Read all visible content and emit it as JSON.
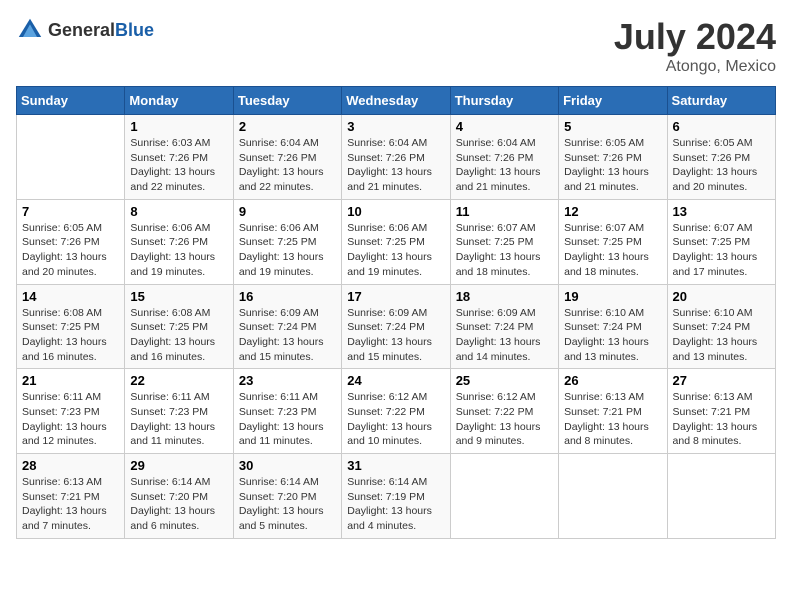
{
  "header": {
    "logo_general": "General",
    "logo_blue": "Blue",
    "title": "July 2024",
    "location": "Atongo, Mexico"
  },
  "days_of_week": [
    "Sunday",
    "Monday",
    "Tuesday",
    "Wednesday",
    "Thursday",
    "Friday",
    "Saturday"
  ],
  "weeks": [
    [
      {
        "day": "",
        "info": ""
      },
      {
        "day": "1",
        "info": "Sunrise: 6:03 AM\nSunset: 7:26 PM\nDaylight: 13 hours\nand 22 minutes."
      },
      {
        "day": "2",
        "info": "Sunrise: 6:04 AM\nSunset: 7:26 PM\nDaylight: 13 hours\nand 22 minutes."
      },
      {
        "day": "3",
        "info": "Sunrise: 6:04 AM\nSunset: 7:26 PM\nDaylight: 13 hours\nand 21 minutes."
      },
      {
        "day": "4",
        "info": "Sunrise: 6:04 AM\nSunset: 7:26 PM\nDaylight: 13 hours\nand 21 minutes."
      },
      {
        "day": "5",
        "info": "Sunrise: 6:05 AM\nSunset: 7:26 PM\nDaylight: 13 hours\nand 21 minutes."
      },
      {
        "day": "6",
        "info": "Sunrise: 6:05 AM\nSunset: 7:26 PM\nDaylight: 13 hours\nand 20 minutes."
      }
    ],
    [
      {
        "day": "7",
        "info": "Sunrise: 6:05 AM\nSunset: 7:26 PM\nDaylight: 13 hours\nand 20 minutes."
      },
      {
        "day": "8",
        "info": "Sunrise: 6:06 AM\nSunset: 7:26 PM\nDaylight: 13 hours\nand 19 minutes."
      },
      {
        "day": "9",
        "info": "Sunrise: 6:06 AM\nSunset: 7:25 PM\nDaylight: 13 hours\nand 19 minutes."
      },
      {
        "day": "10",
        "info": "Sunrise: 6:06 AM\nSunset: 7:25 PM\nDaylight: 13 hours\nand 19 minutes."
      },
      {
        "day": "11",
        "info": "Sunrise: 6:07 AM\nSunset: 7:25 PM\nDaylight: 13 hours\nand 18 minutes."
      },
      {
        "day": "12",
        "info": "Sunrise: 6:07 AM\nSunset: 7:25 PM\nDaylight: 13 hours\nand 18 minutes."
      },
      {
        "day": "13",
        "info": "Sunrise: 6:07 AM\nSunset: 7:25 PM\nDaylight: 13 hours\nand 17 minutes."
      }
    ],
    [
      {
        "day": "14",
        "info": "Sunrise: 6:08 AM\nSunset: 7:25 PM\nDaylight: 13 hours\nand 16 minutes."
      },
      {
        "day": "15",
        "info": "Sunrise: 6:08 AM\nSunset: 7:25 PM\nDaylight: 13 hours\nand 16 minutes."
      },
      {
        "day": "16",
        "info": "Sunrise: 6:09 AM\nSunset: 7:24 PM\nDaylight: 13 hours\nand 15 minutes."
      },
      {
        "day": "17",
        "info": "Sunrise: 6:09 AM\nSunset: 7:24 PM\nDaylight: 13 hours\nand 15 minutes."
      },
      {
        "day": "18",
        "info": "Sunrise: 6:09 AM\nSunset: 7:24 PM\nDaylight: 13 hours\nand 14 minutes."
      },
      {
        "day": "19",
        "info": "Sunrise: 6:10 AM\nSunset: 7:24 PM\nDaylight: 13 hours\nand 13 minutes."
      },
      {
        "day": "20",
        "info": "Sunrise: 6:10 AM\nSunset: 7:24 PM\nDaylight: 13 hours\nand 13 minutes."
      }
    ],
    [
      {
        "day": "21",
        "info": "Sunrise: 6:11 AM\nSunset: 7:23 PM\nDaylight: 13 hours\nand 12 minutes."
      },
      {
        "day": "22",
        "info": "Sunrise: 6:11 AM\nSunset: 7:23 PM\nDaylight: 13 hours\nand 11 minutes."
      },
      {
        "day": "23",
        "info": "Sunrise: 6:11 AM\nSunset: 7:23 PM\nDaylight: 13 hours\nand 11 minutes."
      },
      {
        "day": "24",
        "info": "Sunrise: 6:12 AM\nSunset: 7:22 PM\nDaylight: 13 hours\nand 10 minutes."
      },
      {
        "day": "25",
        "info": "Sunrise: 6:12 AM\nSunset: 7:22 PM\nDaylight: 13 hours\nand 9 minutes."
      },
      {
        "day": "26",
        "info": "Sunrise: 6:13 AM\nSunset: 7:21 PM\nDaylight: 13 hours\nand 8 minutes."
      },
      {
        "day": "27",
        "info": "Sunrise: 6:13 AM\nSunset: 7:21 PM\nDaylight: 13 hours\nand 8 minutes."
      }
    ],
    [
      {
        "day": "28",
        "info": "Sunrise: 6:13 AM\nSunset: 7:21 PM\nDaylight: 13 hours\nand 7 minutes."
      },
      {
        "day": "29",
        "info": "Sunrise: 6:14 AM\nSunset: 7:20 PM\nDaylight: 13 hours\nand 6 minutes."
      },
      {
        "day": "30",
        "info": "Sunrise: 6:14 AM\nSunset: 7:20 PM\nDaylight: 13 hours\nand 5 minutes."
      },
      {
        "day": "31",
        "info": "Sunrise: 6:14 AM\nSunset: 7:19 PM\nDaylight: 13 hours\nand 4 minutes."
      },
      {
        "day": "",
        "info": ""
      },
      {
        "day": "",
        "info": ""
      },
      {
        "day": "",
        "info": ""
      }
    ]
  ]
}
